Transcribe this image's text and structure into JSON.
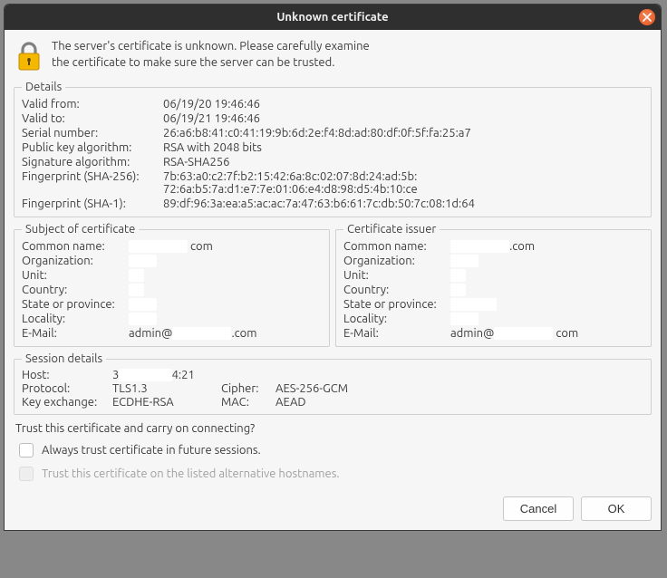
{
  "title": "Unknown certificate",
  "warning_line1": "The server's certificate is unknown. Please carefully examine",
  "warning_line2": "the certificate to make sure the server can be trusted.",
  "details": {
    "legend": "Details",
    "valid_from_label": "Valid from:",
    "valid_from": "06/19/20 19:46:46",
    "valid_to_label": "Valid to:",
    "valid_to": "06/19/21 19:46:46",
    "serial_label": "Serial number:",
    "serial": "26:a6:b8:41:c0:41:19:9b:6d:2e:f4:8d:ad:80:df:0f:5f:fa:25:a7",
    "pubkey_label": "Public key algorithm:",
    "pubkey": "RSA with 2048 bits",
    "sigalg_label": "Signature algorithm:",
    "sigalg": "RSA-SHA256",
    "fp256_label": "Fingerprint (SHA-256):",
    "fp256_line1": "7b:63:a0:c2:7f:b2:15:42:6a:8c:02:07:8d:24:ad:5b:",
    "fp256_line2": "72:6a:b5:7a:d1:e7:7e:01:06:e4:d8:98:d5:4b:10:ce",
    "fp1_label": "Fingerprint (SHA-1):",
    "fp1": "89:df:96:3a:ea:a5:ac:ac:7a:47:63:b6:61:7c:db:50:7c:08:1d:64"
  },
  "subject": {
    "legend": "Subject of certificate",
    "cn_label": "Common name:",
    "cn_suffix": "com",
    "org_label": "Organization:",
    "unit_label": "Unit:",
    "country_label": "Country:",
    "state_label": "State or province:",
    "locality_label": "Locality:",
    "email_label": "E-Mail:",
    "email_prefix": "admin@",
    "email_suffix": ".com"
  },
  "issuer": {
    "legend": "Certificate issuer",
    "cn_label": "Common name:",
    "cn_suffix": ".com",
    "org_label": "Organization:",
    "unit_label": "Unit:",
    "country_label": "Country:",
    "state_label": "State or province:",
    "locality_label": "Locality:",
    "email_label": "E-Mail:",
    "email_prefix": "admin@",
    "email_suffix": "com"
  },
  "session": {
    "legend": "Session details",
    "host_label": "Host:",
    "host_prefix": "3",
    "host_suffix": "4:21",
    "protocol_label": "Protocol:",
    "protocol": "TLS1.3",
    "cipher_label": "Cipher:",
    "cipher": "AES-256-GCM",
    "kex_label": "Key exchange:",
    "kex": "ECDHE-RSA",
    "mac_label": "MAC:",
    "mac": "AEAD"
  },
  "prompt": {
    "question": "Trust this certificate and carry on connecting?",
    "always_trust": "Always trust certificate in future sessions.",
    "trust_alt": "Trust this certificate on the listed alternative hostnames."
  },
  "buttons": {
    "cancel": "Cancel",
    "ok": "OK"
  }
}
